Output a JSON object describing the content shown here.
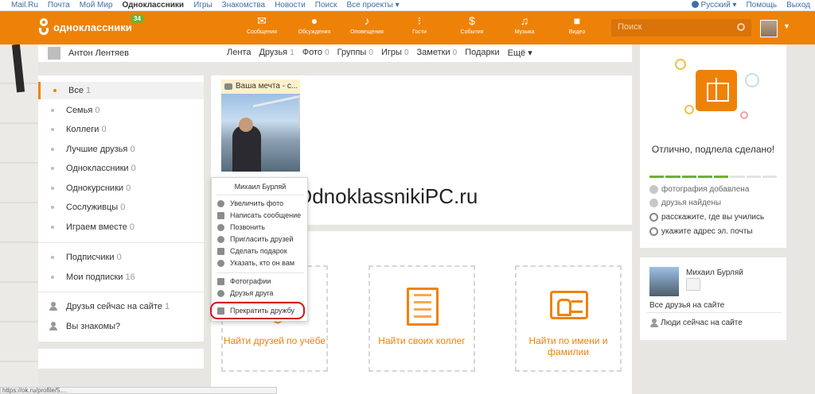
{
  "topbar": {
    "links": [
      "Mail.Ru",
      "Почта",
      "Мой Мир",
      "Одноклассники",
      "Игры",
      "Знакомства",
      "Новости",
      "Поиск",
      "Все проекты ▾"
    ],
    "active_index": 3,
    "language": "Русский ▾",
    "help": "Помощь",
    "logout": "Выход"
  },
  "header": {
    "logo_text": "одноклассники",
    "badge_count": "34",
    "nav": [
      {
        "label": "Сообщения",
        "icon": "envelope-icon"
      },
      {
        "label": "Обсуждения",
        "icon": "chat-bubbles-icon"
      },
      {
        "label": "Оповещения",
        "icon": "bell-icon"
      },
      {
        "label": "Гости",
        "icon": "footprints-icon"
      },
      {
        "label": "События",
        "icon": "events-icon"
      },
      {
        "label": "Музыка",
        "icon": "music-note-icon"
      },
      {
        "label": "Видео",
        "icon": "video-camera-icon"
      }
    ],
    "search_placeholder": "Поиск",
    "brand_color": "#ee8208"
  },
  "profile": {
    "name": "Антон Лентяев",
    "tabs": [
      {
        "label": "Лента",
        "count": ""
      },
      {
        "label": "Друзья",
        "count": "1"
      },
      {
        "label": "Фото",
        "count": "0"
      },
      {
        "label": "Группы",
        "count": "0"
      },
      {
        "label": "Игры",
        "count": "0"
      },
      {
        "label": "Заметки",
        "count": "0"
      },
      {
        "label": "Подарки",
        "count": ""
      },
      {
        "label": "Ещё ▾",
        "count": ""
      }
    ]
  },
  "sidebar": {
    "groups": [
      {
        "label": "Все",
        "count": "1"
      },
      {
        "label": "Семья",
        "count": "0"
      },
      {
        "label": "Коллеги",
        "count": "0"
      },
      {
        "label": "Лучшие друзья",
        "count": "0"
      },
      {
        "label": "Одноклассники",
        "count": "0"
      },
      {
        "label": "Однокурсники",
        "count": "0"
      },
      {
        "label": "Сослуживцы",
        "count": "0"
      },
      {
        "label": "Играем вместе",
        "count": "0"
      }
    ],
    "subs": [
      {
        "label": "Подписчики",
        "count": "0"
      },
      {
        "label": "Мои подписки",
        "count": "16"
      }
    ],
    "online": {
      "label": "Друзья сейчас на сайте",
      "count": "1"
    },
    "know": {
      "label": "Вы знакомы?"
    }
  },
  "friend_card": {
    "photo_caption": "Ваша мечта - с..."
  },
  "context_menu": {
    "title": "Михаил Бурляй",
    "items": [
      "Увеличить фото",
      "Написать сообщение",
      "Позвонить",
      "Пригласить друзей",
      "Сделать подарок",
      "Указать, кто он вам"
    ],
    "items2": [
      "Фотографии",
      "Друзья друга"
    ],
    "stop": "Прекратить дружбу"
  },
  "watermark": "OdnoklassnikiPC.ru",
  "find": [
    {
      "label": "Найти друзей по учёбе",
      "icon": "graduation-cap-icon"
    },
    {
      "label": "Найти своих коллег",
      "icon": "office-building-icon"
    },
    {
      "label": "Найти по имени и фамилии",
      "icon": "id-card-icon"
    }
  ],
  "right": {
    "done_title": "Отлично, подлела сделано!",
    "progress_total": 8,
    "progress_done": 5,
    "checklist": [
      {
        "text": "фотография добавлена",
        "done": true
      },
      {
        "text": "друзья найдены",
        "done": true
      },
      {
        "text": "расскажите, где вы учились",
        "done": false
      },
      {
        "text": "укажите адрес эл. почты",
        "done": false
      }
    ],
    "friend_name": "Михаил Бурляй",
    "all_friends": "Все друзья на сайте",
    "online_now": "Люди сейчас на сайте"
  },
  "status_url": "https://ok.ru/profile/5...."
}
